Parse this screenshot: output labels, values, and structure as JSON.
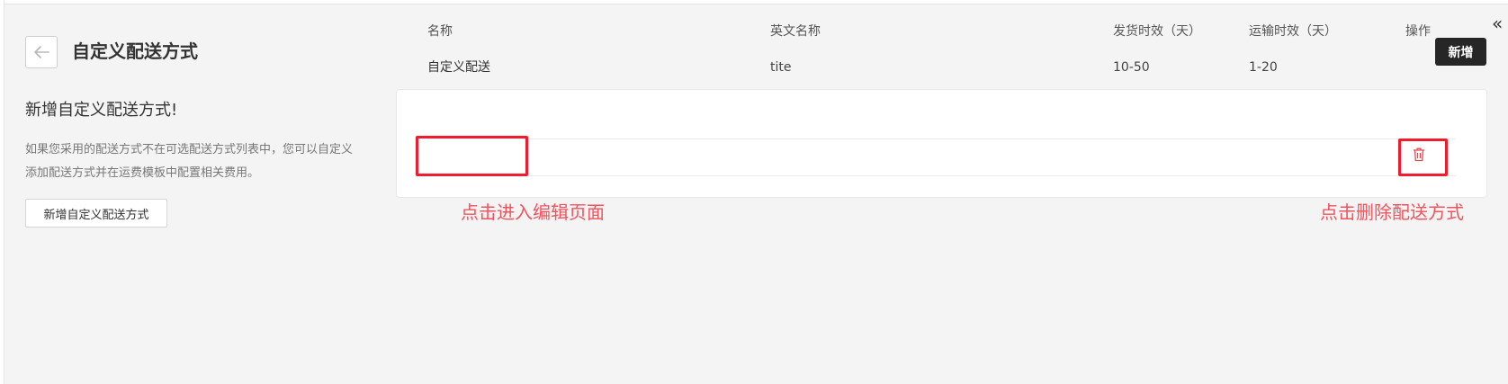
{
  "header": {
    "title": "自定义配送方式",
    "add_button": "新增",
    "collapse_symbol": "«"
  },
  "info": {
    "heading": "新增自定义配送方式!",
    "description": "如果您采用的配送方式不在可选配送方式列表中，您可以自定义添加配送方式并在运费模板中配置相关费用。",
    "button": "新增自定义配送方式"
  },
  "table": {
    "columns": [
      "名称",
      "英文名称",
      "发货时效（天）",
      "运输时效（天）",
      "操作"
    ],
    "rows": [
      {
        "name": "自定义配送",
        "english_name": "tite",
        "ship_time": "10-50",
        "transit_time": "1-20"
      }
    ]
  },
  "annotations": {
    "edit": "点击进入编辑页面",
    "delete": "点击删除配送方式"
  },
  "colors": {
    "highlight": "#ee1c2e",
    "annotation": "#f1535e",
    "delete_icon": "#e04a55",
    "dark_button": "#262626"
  }
}
